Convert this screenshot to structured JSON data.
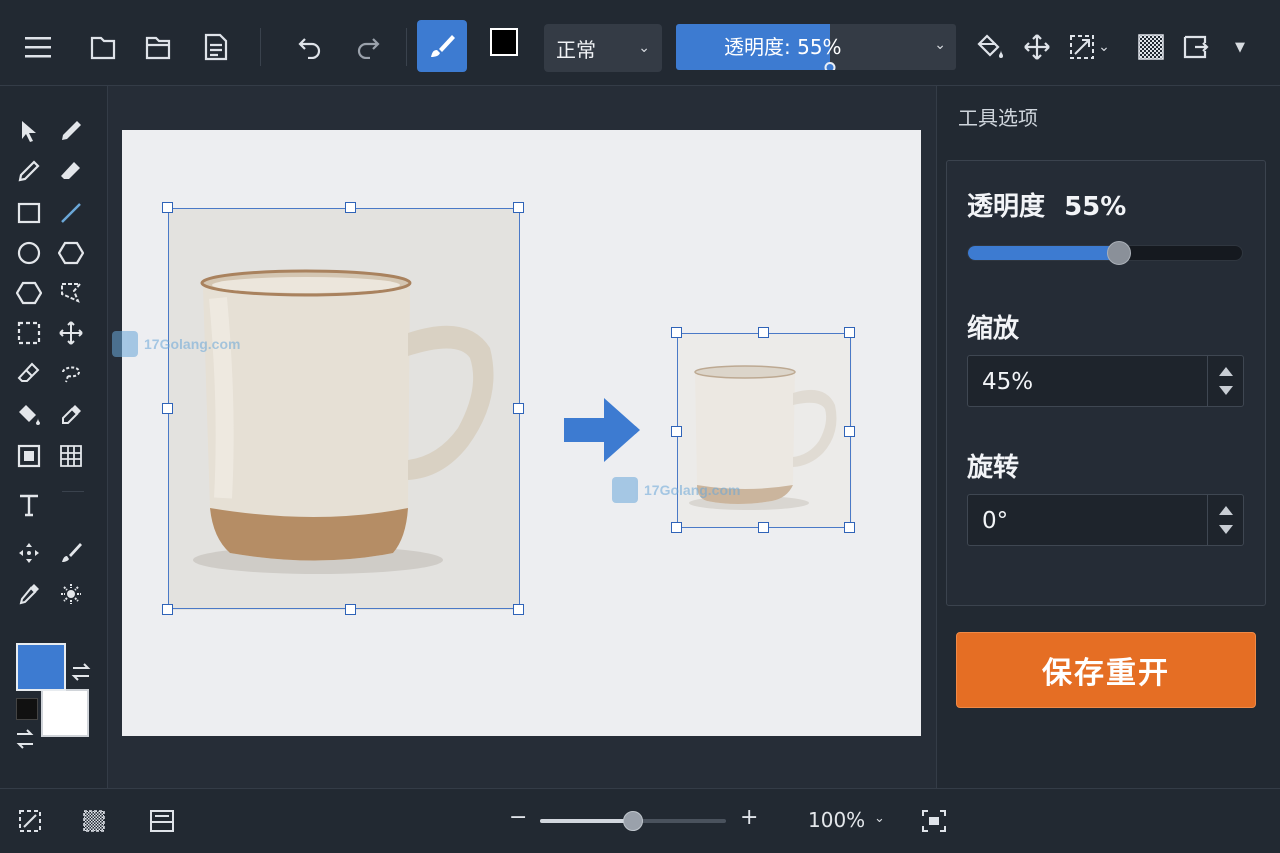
{
  "toolbar": {
    "blend_mode": "正常",
    "opacity_label": "透明度: 55%",
    "opacity_value": 55
  },
  "right_panel": {
    "title": "工具选项",
    "opacity_label": "透明度",
    "opacity_text": "55%",
    "opacity_value": 55,
    "scale_label": "缩放",
    "scale_value": "45%",
    "rotate_label": "旋转",
    "rotate_value": "0°",
    "save_button": "保存重开"
  },
  "bottom": {
    "zoom_minus": "−",
    "zoom_plus": "+",
    "zoom_value": "100%",
    "zoom_slider_value": 50
  },
  "colors": {
    "accent": "#3d7bd1",
    "foreground": "#3d7bd1",
    "background": "#ffffff",
    "save_button": "#e56e24"
  },
  "watermark": {
    "text": "17Golang.com"
  },
  "icons": [
    "menu-icon",
    "new-file-icon",
    "open-folder-icon",
    "document-icon",
    "undo-icon",
    "redo-icon",
    "brush-icon",
    "fill-icon",
    "move-icon",
    "transform-icon",
    "pattern-icon",
    "export-icon"
  ]
}
